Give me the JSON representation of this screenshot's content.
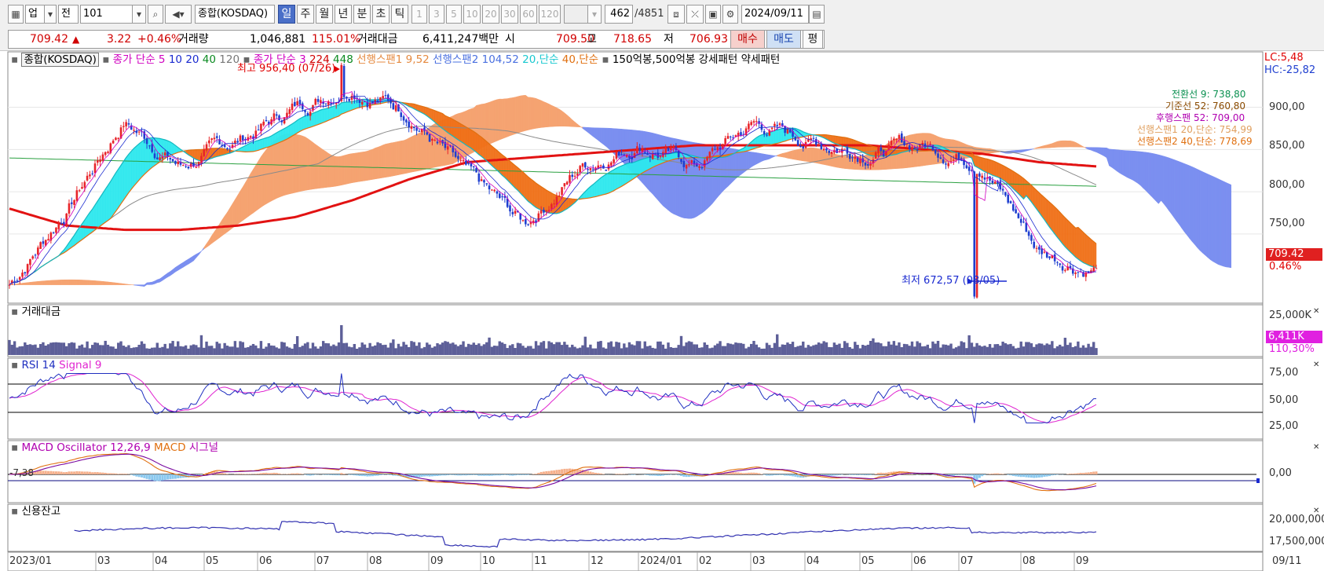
{
  "toolbar": {
    "market_label": "업",
    "period_label": "전",
    "code_value": "101",
    "index_name": "종합(KOSDAQ)",
    "periods": [
      "일",
      "주",
      "월",
      "년",
      "분",
      "초",
      "틱"
    ],
    "active_period": "일",
    "minute_steps": [
      "1",
      "3",
      "5",
      "10",
      "20",
      "30",
      "60",
      "120"
    ],
    "count_value": "462",
    "count_total": "/4851",
    "date_value": "2024/09/11"
  },
  "quote": {
    "price": "709.42",
    "up_icon": "triangle-up-icon",
    "change": "3.22",
    "change_pct": "+0.46%",
    "volume_label": "거래량",
    "volume": "1,046,881",
    "volume_ratio": "115.01%",
    "value_label": "거래대금",
    "value": "6,411,247백만",
    "open_label": "시",
    "open": "709.50",
    "high_label": "고",
    "high": "718.65",
    "low_label": "저",
    "low": "706.93",
    "buy_label": "매수",
    "sell_label": "매도",
    "eval_label": "평"
  },
  "price_panel": {
    "legend": {
      "index": "종합(KOSDAQ)",
      "ma_label": "종가 단순 5",
      "ma10": "10",
      "ma20": "20",
      "ma40": "40",
      "ma120": "120",
      "ma2_label": "종가 단순 3",
      "ma224": "224",
      "ma448": "448",
      "span1": "선행스팬1 9,52",
      "span2": "선행스팬2 104,52",
      "ma20s": "20,단순",
      "ma40s": "40,단순",
      "pattern": "150억봉,500억봉 강세패턴",
      "weak": "약세패턴"
    },
    "lc": "LC:5,48",
    "hc": "HC:-25,82",
    "high_note": "최고 956,40 (07/26)",
    "low_note": "최저 672,57 (08/05)",
    "price_tag": "709.42",
    "pct_tag": "0.46%",
    "right_notes": [
      "전환선 9: 738,80",
      "기준선 52: 760,80",
      "후행스팬 52: 709,00",
      "선행스팬1 20,단순: 754,99",
      "선행스팬2 40,단순: 778,69"
    ],
    "y_ticks": [
      "900,00",
      "850,00",
      "800,00",
      "750,00"
    ]
  },
  "value_panel": {
    "title": "거래대금",
    "y_tick": "25,000K",
    "tag1": "6,411K",
    "tag2": "110,30%"
  },
  "rsi_panel": {
    "title": "RSI 14",
    "signal": "Signal 9",
    "y_ticks": [
      "75,00",
      "50,00",
      "25,00"
    ]
  },
  "macd_panel": {
    "title": "MACD Oscillator 12,26,9",
    "macd": "MACD",
    "signal": "시그널",
    "left_value": "-7,38",
    "y_tick": "0,00"
  },
  "credit_panel": {
    "title": "신용잔고",
    "y_ticks": [
      "20,000,000",
      "17,500,000"
    ]
  },
  "x_axis": [
    "2023/01",
    "03",
    "04",
    "05",
    "06",
    "07",
    "08",
    "09",
    "10",
    "11",
    "12",
    "2024/01",
    "02",
    "03",
    "04",
    "05",
    "06",
    "07",
    "08",
    "09"
  ],
  "x_right": "09/11",
  "colors": {
    "up": "#e8242a",
    "down": "#1f3fd0",
    "span1_cloud": "#f5a371",
    "span2_cloud": "#7b8ff0",
    "ma224": "#e21212",
    "value_bar": "#5d5f98",
    "rsi": "#1f2fc0",
    "rsi_signal": "#e024d0"
  },
  "chart_data": {
    "type": "line",
    "title": "종합(KOSDAQ)",
    "x": [
      "2023/01",
      "03",
      "04",
      "05",
      "06",
      "07",
      "08",
      "09",
      "10",
      "11",
      "12",
      "2024/01",
      "02",
      "03",
      "04",
      "05",
      "06",
      "07",
      "08",
      "09"
    ],
    "series": [
      {
        "name": "종합(KOSDAQ)",
        "values": [
          690,
          780,
          885,
          830,
          860,
          900,
          930,
          895,
          815,
          760,
          830,
          860,
          830,
          880,
          860,
          850,
          855,
          840,
          730,
          709
        ]
      },
      {
        "name": "224",
        "values": [
          780,
          760,
          755,
          755,
          760,
          770,
          790,
          815,
          835,
          840,
          845,
          850,
          855,
          855,
          855,
          855,
          850,
          845,
          835,
          830
        ]
      }
    ],
    "ylim": [
      670,
      960
    ],
    "y_ticks": [
      750,
      800,
      850,
      900
    ],
    "annotations": [
      "최고 956,40 (07/26)",
      "최저 672,57 (08/05)"
    ]
  }
}
